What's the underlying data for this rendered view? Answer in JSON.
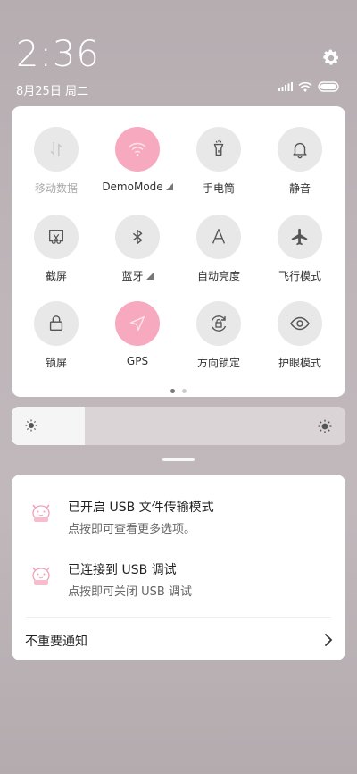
{
  "status": {
    "time": "2:36",
    "date": "8月25日 周二"
  },
  "quick_settings": {
    "tiles": [
      {
        "label": "移动数据",
        "icon": "mobile-data-icon",
        "active": false,
        "disabled": true
      },
      {
        "label": "DemoMode",
        "icon": "wifi-icon",
        "active": true,
        "disabled": false
      },
      {
        "label": "手电筒",
        "icon": "flashlight-icon",
        "active": false,
        "disabled": false
      },
      {
        "label": "静音",
        "icon": "bell-icon",
        "active": false,
        "disabled": false
      },
      {
        "label": "截屏",
        "icon": "screenshot-icon",
        "active": false,
        "disabled": false
      },
      {
        "label": "蓝牙",
        "icon": "bluetooth-icon",
        "active": false,
        "disabled": false
      },
      {
        "label": "自动亮度",
        "icon": "auto-brightness-icon",
        "active": false,
        "disabled": false
      },
      {
        "label": "飞行模式",
        "icon": "airplane-icon",
        "active": false,
        "disabled": false
      },
      {
        "label": "锁屏",
        "icon": "lock-icon",
        "active": false,
        "disabled": false
      },
      {
        "label": "GPS",
        "icon": "location-arrow-icon",
        "active": true,
        "disabled": false
      },
      {
        "label": "方向锁定",
        "icon": "rotation-lock-icon",
        "active": false,
        "disabled": false
      },
      {
        "label": "护眼模式",
        "icon": "eye-icon",
        "active": false,
        "disabled": false
      }
    ],
    "page_count": 2,
    "current_page": 1
  },
  "brightness": {
    "level": 0.22
  },
  "notifications": [
    {
      "title": "已开启 USB 文件传输模式",
      "subtitle": "点按即可查看更多选项。",
      "icon": "cat-app-icon"
    },
    {
      "title": "已连接到 USB 调试",
      "subtitle": "点按即可关闭 USB 调试",
      "icon": "cat-app-icon"
    }
  ],
  "unimportant_label": "不重要通知",
  "colors": {
    "active_tile": "#f7a9bf",
    "inactive_tile": "#e8e8e8"
  }
}
